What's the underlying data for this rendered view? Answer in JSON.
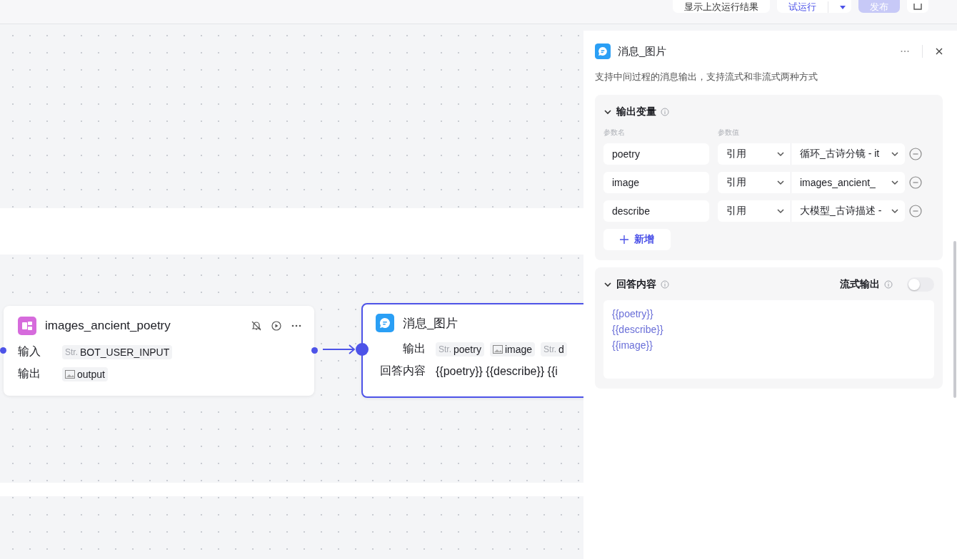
{
  "toolbar": {
    "buttons": [
      {
        "label": "显示上次运行结果",
        "kind": "plain"
      },
      {
        "label": "试运行",
        "kind": "split"
      },
      {
        "label": "发布",
        "kind": "primary",
        "disabled": true
      },
      {
        "kind": "icon"
      }
    ]
  },
  "nodes": [
    {
      "title": "images_ancient_poetry",
      "kind": "plugin",
      "selected": false,
      "rows": [
        {
          "label": "输入",
          "tags": [
            {
              "kind": "str",
              "prefix": "Str.",
              "text": "BOT_USER_INPUT"
            }
          ]
        },
        {
          "label": "输出",
          "tags": [
            {
              "kind": "image",
              "text": "output"
            }
          ]
        }
      ]
    },
    {
      "title": "消息_图片",
      "kind": "message",
      "selected": true,
      "rows": [
        {
          "label": "输出",
          "tags": [
            {
              "kind": "str",
              "prefix": "Str.",
              "text": "poetry"
            },
            {
              "kind": "image",
              "text": "image"
            },
            {
              "kind": "str",
              "prefix": "Str.",
              "text": "d"
            }
          ]
        },
        {
          "label": "回答内容",
          "text": "{{poetry}} {{describe}} {{i"
        }
      ]
    }
  ],
  "panel": {
    "title": "消息_图片",
    "description": "支持中间过程的消息输出，支持流式和非流式两种方式",
    "output_variables": {
      "title": "输出变量",
      "expanded": true,
      "columns": [
        "参数名",
        "参数值"
      ],
      "rows": [
        {
          "name": "poetry",
          "type": "引用",
          "value": "循环_古诗分镜 - it"
        },
        {
          "name": "image",
          "type": "引用",
          "value": "images_ancient_"
        },
        {
          "name": "describe",
          "type": "引用",
          "value": "大模型_古诗描述 -"
        }
      ],
      "add_label": "新增"
    },
    "answer": {
      "title": "回答内容",
      "expanded": true,
      "stream_label": "流式输出",
      "stream_on": false,
      "lines": [
        "{{poetry}}",
        "{{describe}}",
        "{{image}}"
      ]
    }
  }
}
